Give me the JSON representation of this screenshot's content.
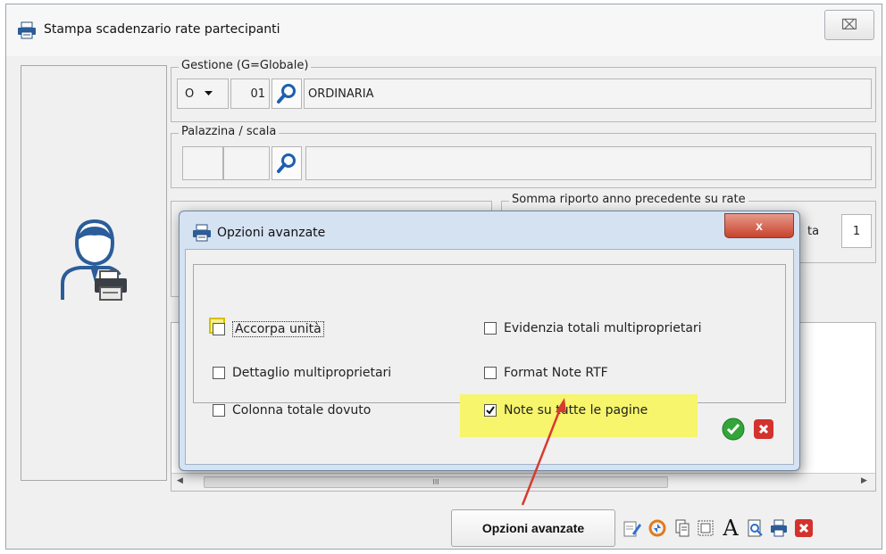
{
  "window": {
    "title": "Stampa scadenzario rate partecipanti",
    "close_glyph": "⌧"
  },
  "gestione": {
    "legend": "Gestione (G=Globale)",
    "type_value": "O",
    "code_value": "01",
    "description_value": "ORDINARIA"
  },
  "palazzina": {
    "legend": "Palazzina / scala",
    "code1": "",
    "code2": "",
    "description": ""
  },
  "somma": {
    "legend": "Somma riporto anno precedente su rate",
    "partial_label": "ta",
    "value": "1"
  },
  "list_scroll": {
    "thumb_glyph": "III"
  },
  "toolbar": {
    "advanced_label": "Opzioni avanzate",
    "icons": [
      "edit-icon",
      "refresh-icon",
      "copy-pages-icon",
      "page-frame-icon",
      "font-icon",
      "print-preview-icon",
      "print-icon",
      "close-icon"
    ],
    "font_glyph": "A"
  },
  "modal": {
    "title": "Opzioni avanzate",
    "close_glyph": "x",
    "options": [
      {
        "label": "Accorpa unità",
        "checked": false
      },
      {
        "label": "Dettaglio multiproprietari",
        "checked": false
      },
      {
        "label": "Colonna totale dovuto",
        "checked": false
      },
      {
        "label": "Evidenzia totali multiproprietari",
        "checked": false
      },
      {
        "label": "Format Note RTF",
        "checked": false
      },
      {
        "label": "Note su tutte le pagine",
        "checked": true
      }
    ]
  },
  "colors": {
    "highlight": "#f6f56c",
    "annotation_arrow": "#d83a2f",
    "accent_blue": "#1c5fb0",
    "ok_green": "#34a53a",
    "cancel_red": "#d3322d"
  }
}
